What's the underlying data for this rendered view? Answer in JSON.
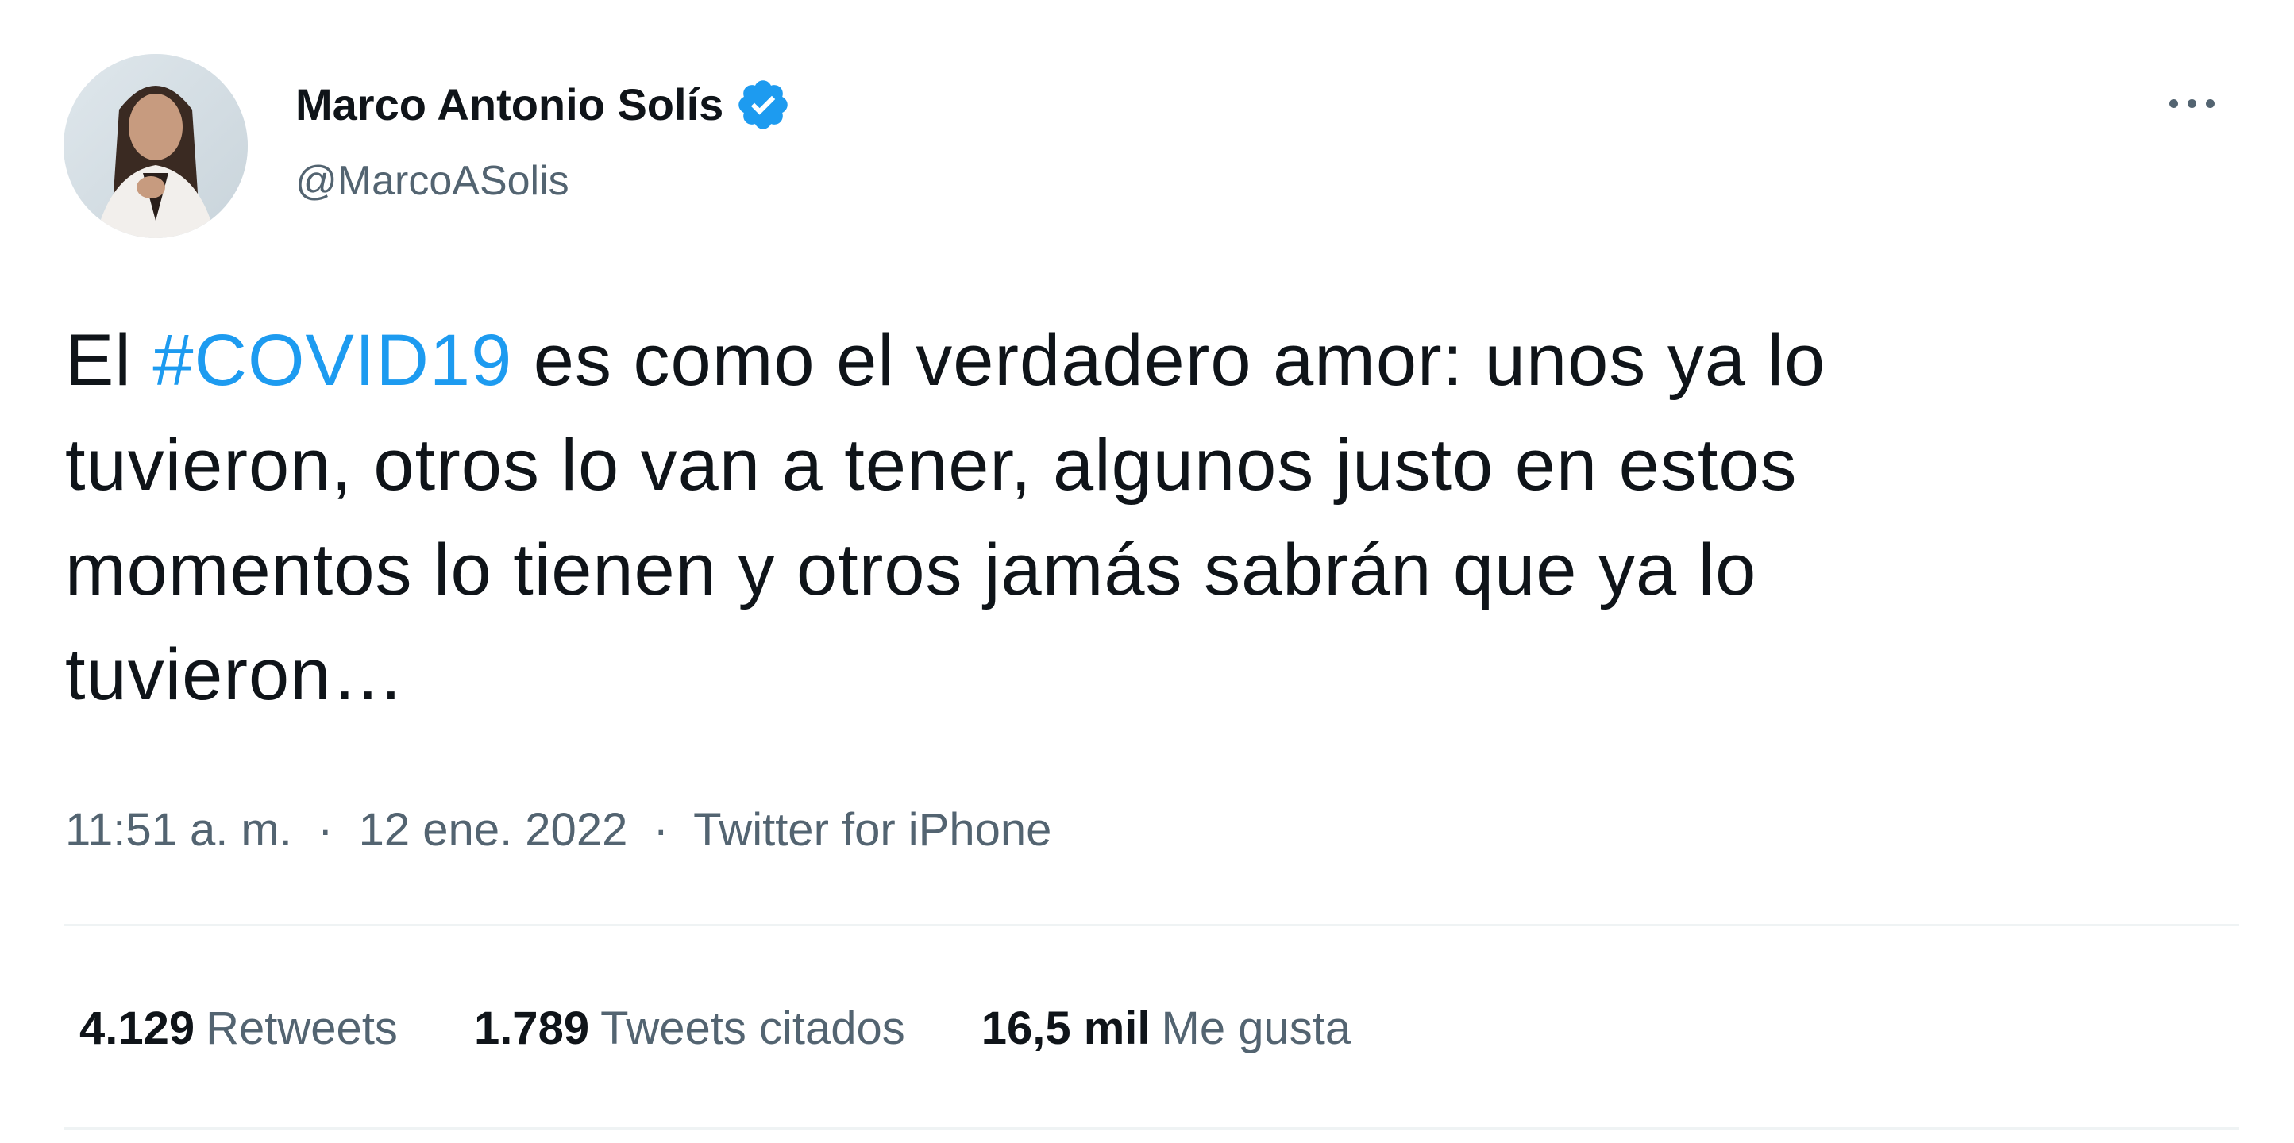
{
  "author": {
    "display_name": "Marco Antonio Solís",
    "handle": "@MarcoASolis",
    "verified": true,
    "avatar_icon": "profile-photo"
  },
  "menu": {
    "more_icon": "more-horizontal-icon"
  },
  "tweet": {
    "lines": [
      {
        "prefix": "El ",
        "hashtag": "#COVID19",
        "suffix": " es como el verdadero amor: unos ya lo"
      },
      {
        "text": "tuvieron, otros lo van a tener, algunos justo en estos"
      },
      {
        "text": "momentos lo tienen y otros jamás sabrán que ya lo"
      },
      {
        "text": "tuvieron…"
      }
    ]
  },
  "meta": {
    "time": "11:51 a. m.",
    "separator": "·",
    "date": "12 ene. 2022",
    "source": "Twitter for iPhone"
  },
  "stats": {
    "retweets": {
      "count": "4.129",
      "label": "Retweets"
    },
    "quotes": {
      "count": "1.789",
      "label": "Tweets citados"
    },
    "likes": {
      "count": "16,5 mil",
      "label": "Me gusta"
    }
  },
  "colors": {
    "link": "#1d9bf0",
    "secondary_text": "#536471",
    "primary_text": "#0f1419",
    "verified_badge": "#1d9bf0"
  }
}
